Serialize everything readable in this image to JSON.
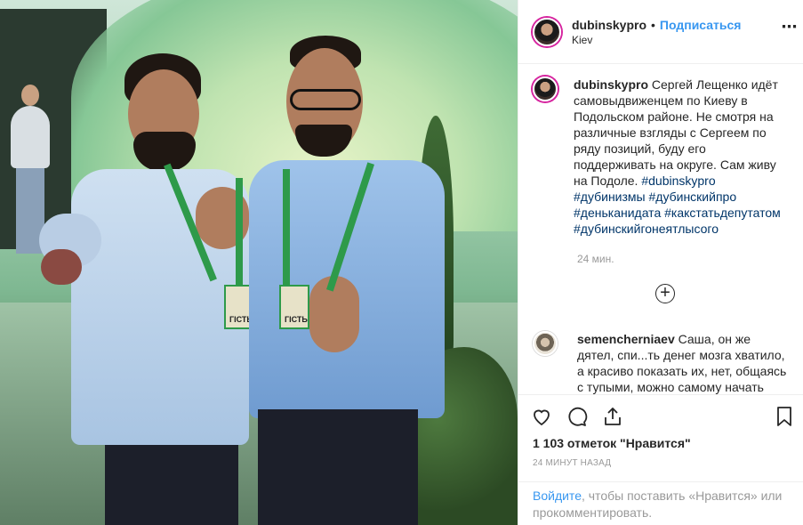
{
  "post": {
    "username": "dubinskypro",
    "dot": "•",
    "follow_label": "Подписаться",
    "location": "Kiev",
    "more_icon": "⋯"
  },
  "caption": {
    "username": "dubinskypro",
    "text": " Сергей Лещенко идёт самовыдвиженцем по Киеву в Подольском районе. Не смотря на различные взгляды с Сергеем по ряду позиций, буду его поддерживать на округе. Сам живу на Подоле. ",
    "hashtags": [
      "#dubinskypro",
      "#дубинизмы",
      "#дубинскийпро",
      "#деньканидата",
      "#какстатьдепутатом",
      "#дубинскийгонеятлысого"
    ],
    "time": "24 мин."
  },
  "load_more_icon": "+",
  "comments": [
    {
      "username": "semencherniaev",
      "text": " Саша, он же дятел, спи...ть денег мозга хватило, а красиво показать их, нет, общаясь с тупыми, можно самому начать"
    }
  ],
  "actions": {
    "likes": "1 103 отметок \"Нравится\"",
    "post_time": "24 МИНУТ НАЗАД"
  },
  "login_prompt": {
    "link": "Войдите",
    "rest": ", чтобы поставить «Нравится» или прокомментировать."
  },
  "photo_badges": [
    "ГІСТЬ",
    "ГІСТЬ"
  ]
}
